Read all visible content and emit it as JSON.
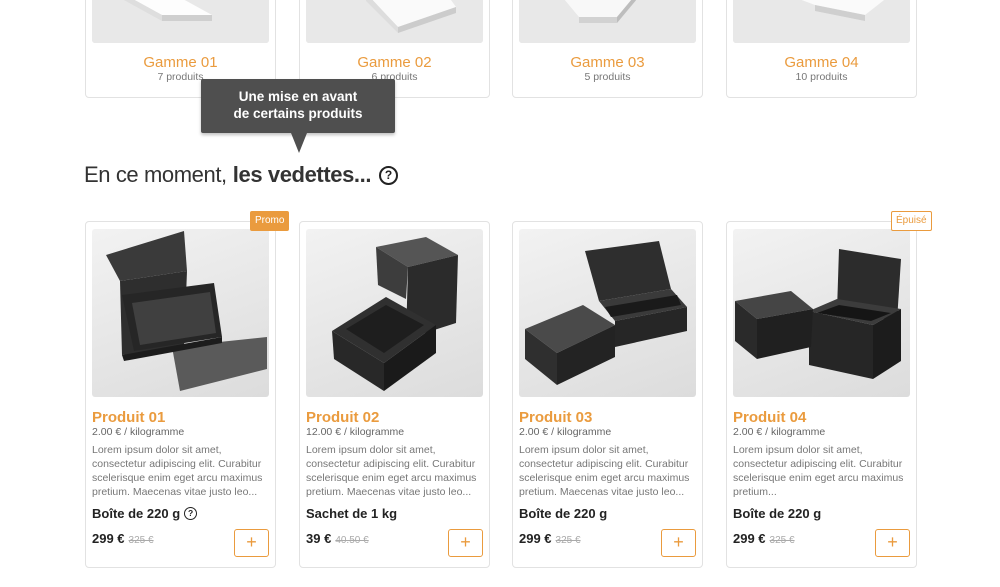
{
  "categories": [
    {
      "name": "Gamme 01",
      "count": "7 produits"
    },
    {
      "name": "Gamme 02",
      "count": "6 produits"
    },
    {
      "name": "Gamme 03",
      "count": "5 produits"
    },
    {
      "name": "Gamme 04",
      "count": "10 produits"
    }
  ],
  "tooltip": {
    "line1": "Une mise en avant",
    "line2": "de certains produits"
  },
  "section": {
    "title_light": "En ce moment,",
    "title_bold": "les vedettes...",
    "help_glyph": "?"
  },
  "products": [
    {
      "name": "Produit 01",
      "unit_price": "2.00 € / kilogramme",
      "description": "Lorem ipsum dolor sit amet, consectetur adipiscing elit. Curabitur scelerisque enim eget arcu maximus pretium. Maecenas vitae justo leo...",
      "packaging": "Boîte de 220 g",
      "price": "299 €",
      "old_price": "325 €",
      "badge": "Promo",
      "add_label": "+"
    },
    {
      "name": "Produit 02",
      "unit_price": "12.00 € / kilogramme",
      "description": "Lorem ipsum dolor sit amet, consectetur adipiscing elit. Curabitur scelerisque enim eget arcu maximus pretium. Maecenas vitae justo leo...",
      "packaging": "Sachet de 1 kg",
      "price": "39 €",
      "old_price": "40.50 €",
      "add_label": "+"
    },
    {
      "name": "Produit 03",
      "unit_price": "2.00 € / kilogramme",
      "description": "Lorem ipsum dolor sit amet, consectetur adipiscing elit. Curabitur scelerisque enim eget arcu maximus pretium. Maecenas vitae justo leo...",
      "packaging": "Boîte de 220 g",
      "price": "299 €",
      "old_price": "325 €",
      "add_label": "+"
    },
    {
      "name": "Produit 04",
      "unit_price": "2.00 € / kilogramme",
      "description": "Lorem ipsum dolor sit amet, consectetur adipiscing elit. Curabitur scelerisque enim eget arcu maximus pretium...",
      "packaging": "Boîte de 220 g",
      "price": "299 €",
      "old_price": "325 €",
      "badge": "Épuisé",
      "add_label": "+"
    }
  ],
  "colors": {
    "accent": "#ea9b3e",
    "tooltip_bg": "#4f4f4f",
    "border": "#e2e2e2"
  }
}
